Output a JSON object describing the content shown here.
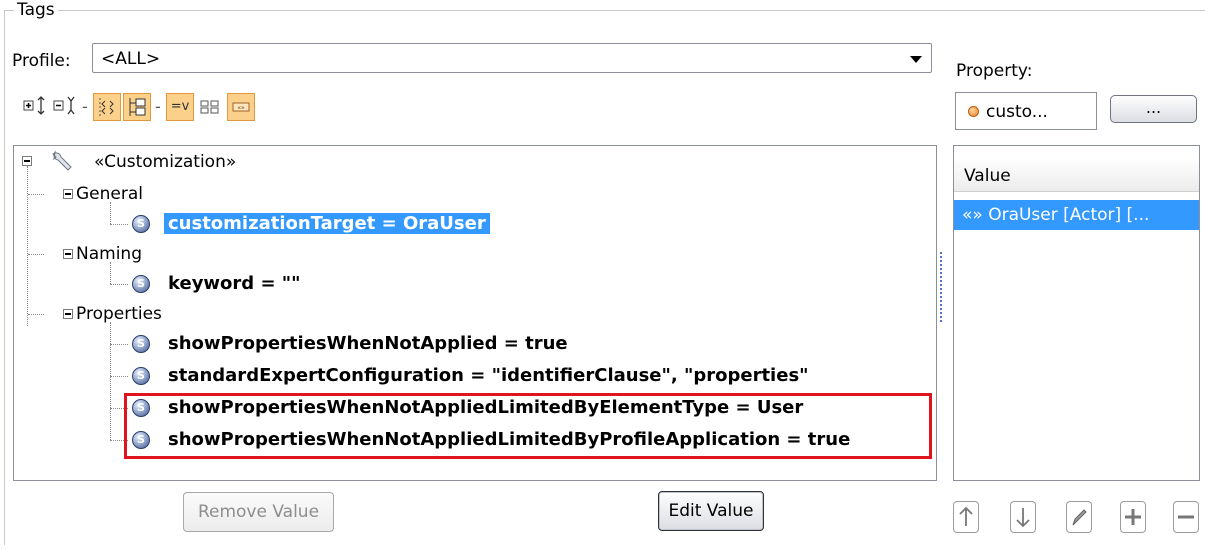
{
  "group": {
    "title": "Tags"
  },
  "profile": {
    "label": "Profile:",
    "value": "<ALL>"
  },
  "property": {
    "label": "Property:",
    "value": "custo...",
    "browse_label": "..."
  },
  "toolbar": {
    "separator": "-",
    "equals_label": "=v"
  },
  "tree": {
    "root": {
      "label": "«Customization»"
    },
    "categories": [
      {
        "label": "General",
        "items": [
          {
            "text": "customizationTarget = OraUser",
            "selected": true
          }
        ]
      },
      {
        "label": "Naming",
        "items": [
          {
            "text": "keyword = \"\"",
            "selected": false
          }
        ]
      },
      {
        "label": "Properties",
        "items": [
          {
            "text": "showPropertiesWhenNotApplied = true",
            "selected": false
          },
          {
            "text": "standardExpertConfiguration = \"identifierClause\", \"properties\"",
            "selected": false
          },
          {
            "text": "showPropertiesWhenNotAppliedLimitedByElementType = User",
            "selected": false
          },
          {
            "text": "showPropertiesWhenNotAppliedLimitedByProfileApplication = true",
            "selected": false
          }
        ]
      }
    ],
    "stereotype_glyph": "S"
  },
  "value_panel": {
    "header": "Value",
    "rows": [
      {
        "text": "«» OraUser [Actor] [..."
      }
    ]
  },
  "buttons": {
    "remove_value": "Remove Value",
    "edit_value": "Edit Value"
  },
  "colors": {
    "selection": "#3399ff",
    "highlight_border": "#e0141e",
    "toolbar_selected": "#fbd08a"
  }
}
